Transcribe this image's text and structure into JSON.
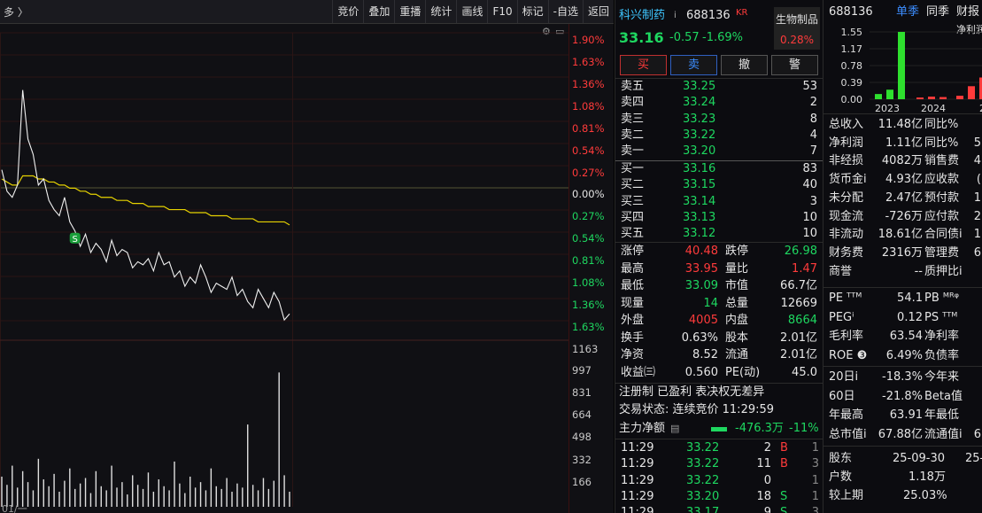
{
  "toolbar": {
    "left_label": "多 〉",
    "buttons": [
      "竞价",
      "叠加",
      "重播",
      "统计",
      "画线",
      "F10",
      "标记",
      "-自选",
      "返回"
    ]
  },
  "axis": {
    "pct_labels": [
      "1.90%",
      "1.63%",
      "1.36%",
      "1.08%",
      "0.81%",
      "0.54%",
      "0.27%",
      "0.00%",
      "0.27%",
      "0.54%",
      "0.81%",
      "1.08%",
      "1.36%",
      "1.63%"
    ],
    "vol_labels": [
      "1163",
      "997",
      "831",
      "664",
      "498",
      "332",
      "166"
    ],
    "date_label": "01/一"
  },
  "chart_data": {
    "type": "line",
    "price_series": [
      33.45,
      33.38,
      33.36,
      33.4,
      33.71,
      33.55,
      33.5,
      33.4,
      33.42,
      33.35,
      33.32,
      33.3,
      33.36,
      33.28,
      33.25,
      33.2,
      33.24,
      33.18,
      33.21,
      33.19,
      33.15,
      33.22,
      33.17,
      33.19,
      33.18,
      33.13,
      33.15,
      33.14,
      33.16,
      33.12,
      33.18,
      33.14,
      33.15,
      33.1,
      33.12,
      33.07,
      33.1,
      33.08,
      33.14,
      33.1,
      33.05,
      33.08,
      33.07,
      33.06,
      33.1,
      33.04,
      33.06,
      33.02,
      33.0,
      33.06,
      33.03,
      33.0,
      33.05,
      33.02,
      32.96,
      32.98
    ],
    "avg_series": [
      33.42,
      33.41,
      33.4,
      33.4,
      33.43,
      33.43,
      33.43,
      33.42,
      33.42,
      33.41,
      33.41,
      33.4,
      33.4,
      33.39,
      33.39,
      33.38,
      33.38,
      33.37,
      33.37,
      33.36,
      33.36,
      33.36,
      33.35,
      33.35,
      33.35,
      33.34,
      33.34,
      33.34,
      33.33,
      33.33,
      33.33,
      33.33,
      33.32,
      33.32,
      33.32,
      33.32,
      33.31,
      33.31,
      33.31,
      33.31,
      33.3,
      33.3,
      33.3,
      33.3,
      33.29,
      33.29,
      33.29,
      33.29,
      33.29,
      33.28,
      33.28,
      33.28,
      33.28,
      33.28,
      33.28,
      33.27
    ],
    "volume_series": [
      220,
      160,
      300,
      140,
      260,
      180,
      120,
      350,
      200,
      150,
      240,
      110,
      190,
      280,
      130,
      170,
      210,
      100,
      260,
      150,
      120,
      300,
      140,
      180,
      90,
      230,
      160,
      130,
      250,
      110,
      200,
      150,
      120,
      330,
      170,
      100,
      220,
      140,
      180,
      120,
      280,
      150,
      130,
      210,
      110,
      170,
      140,
      600,
      160,
      120,
      210,
      130,
      190,
      980,
      230,
      110
    ],
    "y_range": [
      32.92,
      33.81
    ],
    "prev_close": 33.81,
    "vol_ylim": [
      0,
      1163
    ]
  },
  "quote": {
    "name": "科兴制药",
    "name_suffix": "i",
    "code": "688136",
    "code_tag": "KR",
    "price": "33.16",
    "change": "-0.57",
    "change_pct": "-1.69%",
    "sector": "生物制品",
    "sector_pct": "0.28%",
    "buttons": [
      "买",
      "卖",
      "撤",
      "警"
    ]
  },
  "order_book": {
    "asks": [
      {
        "label": "卖五",
        "price": "33.25",
        "vol": "53"
      },
      {
        "label": "卖四",
        "price": "33.24",
        "vol": "2"
      },
      {
        "label": "卖三",
        "price": "33.23",
        "vol": "8"
      },
      {
        "label": "卖二",
        "price": "33.22",
        "vol": "4"
      },
      {
        "label": "卖一",
        "price": "33.20",
        "vol": "7"
      }
    ],
    "bids": [
      {
        "label": "买一",
        "price": "33.16",
        "vol": "83"
      },
      {
        "label": "买二",
        "price": "33.15",
        "vol": "40"
      },
      {
        "label": "买三",
        "price": "33.14",
        "vol": "3"
      },
      {
        "label": "买四",
        "price": "33.13",
        "vol": "10"
      },
      {
        "label": "买五",
        "price": "33.12",
        "vol": "10"
      }
    ]
  },
  "stats": [
    {
      "l1": "涨停",
      "v1": "40.48",
      "c1": "red",
      "l2": "跌停",
      "v2": "26.98",
      "c2": "green"
    },
    {
      "l1": "最高",
      "v1": "33.95",
      "c1": "red",
      "l2": "量比",
      "v2": "1.47",
      "c2": "red"
    },
    {
      "l1": "最低",
      "v1": "33.09",
      "c1": "green",
      "l2": "市值",
      "v2": "66.7亿",
      "c2": "white"
    },
    {
      "l1": "现量",
      "v1": "14",
      "c1": "green",
      "l2": "总量",
      "v2": "12669",
      "c2": "white"
    },
    {
      "l1": "外盘",
      "v1": "4005",
      "c1": "red",
      "l2": "内盘",
      "v2": "8664",
      "c2": "green"
    },
    {
      "l1": "换手",
      "v1": "0.63%",
      "c1": "white",
      "l2": "股本",
      "v2": "2.01亿",
      "c2": "white"
    },
    {
      "l1": "净资",
      "v1": "8.52",
      "c1": "white",
      "l2": "流通",
      "v2": "2.01亿",
      "c2": "white"
    },
    {
      "l1": "收益㈢",
      "v1": "0.560",
      "c1": "white",
      "l2": "PE(动)",
      "v2": "45.0",
      "c2": "white"
    }
  ],
  "tags_line": "注册制 已盈利 表决权无差异",
  "trade_status": "交易状态: 连续竞价 11:29:59",
  "main_flow": {
    "label": "主力净额",
    "value": "-476.3万",
    "pct": "-11%"
  },
  "ticks": [
    {
      "time": "11:29",
      "price": "33.22",
      "pc": "green",
      "vol": "2",
      "bs": "B",
      "bsc": "red",
      "n": "1"
    },
    {
      "time": "11:29",
      "price": "33.22",
      "pc": "green",
      "vol": "11",
      "bs": "B",
      "bsc": "red",
      "n": "3"
    },
    {
      "time": "11:29",
      "price": "33.22",
      "pc": "green",
      "vol": "0",
      "bs": "",
      "bsc": "red",
      "n": "1"
    },
    {
      "time": "11:29",
      "price": "33.20",
      "pc": "green",
      "vol": "18",
      "bs": "S",
      "bsc": "green",
      "n": "1"
    },
    {
      "time": "11:29",
      "price": "33.17",
      "pc": "green",
      "vol": "9",
      "bs": "S",
      "bsc": "green",
      "n": "3"
    }
  ],
  "fin": {
    "code": "688136",
    "tab1": "单季",
    "tab2": "同季",
    "tab3": "财报",
    "subtitle": "净利润",
    "y_labels": [
      "1.55",
      "1.17",
      "0.78",
      "0.39",
      "0.00"
    ],
    "x_labels": [
      "2023",
      "2024",
      "20"
    ],
    "bars": [
      0.12,
      0.22,
      1.55,
      0.04,
      0.06,
      0.05,
      0.08,
      0.3,
      0.5
    ],
    "rows": [
      {
        "l1": "总收入",
        "v1": "11.48亿",
        "l2": "同比%",
        "v2": ""
      },
      {
        "l1": "净利润",
        "v1": "1.11亿",
        "l2": "同比%",
        "v2": "5"
      },
      {
        "l1": "非经损",
        "v1": "4082万",
        "l2": "销售费",
        "v2": "4"
      },
      {
        "l1": "货币金i",
        "v1": "4.93亿",
        "l2": "应收款",
        "v2": "("
      },
      {
        "l1": "未分配",
        "v1": "2.47亿",
        "l2": "预付款",
        "v2": "1"
      },
      {
        "l1": "现金流",
        "v1": "-726万",
        "l2": "应付款",
        "v2": "2"
      },
      {
        "l1": "非流动",
        "v1": "18.61亿",
        "l2": "合同债i",
        "v2": "1"
      },
      {
        "l1": "财务费",
        "v1": "2316万",
        "l2": "管理费",
        "v2": "6"
      },
      {
        "l1": "商誉",
        "v1": "--",
        "l2": "质押比i",
        "v2": ""
      }
    ],
    "rows2": [
      {
        "l1": "PE ᵀᵀᴹ",
        "v1": "54.1",
        "l2": "PB ᴹᴿᵠ",
        "v2": ""
      },
      {
        "l1": "PEGⁱ",
        "v1": "0.12",
        "l2": "PS ᵀᵀᴹ",
        "v2": ""
      },
      {
        "l1": "毛利率",
        "v1": "63.54",
        "l2": "净利率",
        "v2": ""
      },
      {
        "l1": "ROE ❸",
        "v1": "6.49%",
        "l2": "负债率",
        "v2": ""
      }
    ],
    "rows3": [
      {
        "l1": "20日i",
        "v1": "-18.3%",
        "l2": "今年来",
        "v2": ""
      },
      {
        "l1": "60日",
        "v1": "-21.8%",
        "l2": "Beta值",
        "v2": ""
      },
      {
        "l1": "年最高",
        "v1": "63.91",
        "l2": "年最低",
        "v2": ""
      },
      {
        "l1": "总市值i",
        "v1": "67.88亿",
        "l2": "流通值i",
        "v2": "6"
      }
    ],
    "holders_label": "股东",
    "holders_date": "25-09-30",
    "holders_date2": "25-",
    "households_label": "户数",
    "households": "1.18万",
    "vs_last_label": "较上期",
    "vs_last": "25.03%"
  }
}
